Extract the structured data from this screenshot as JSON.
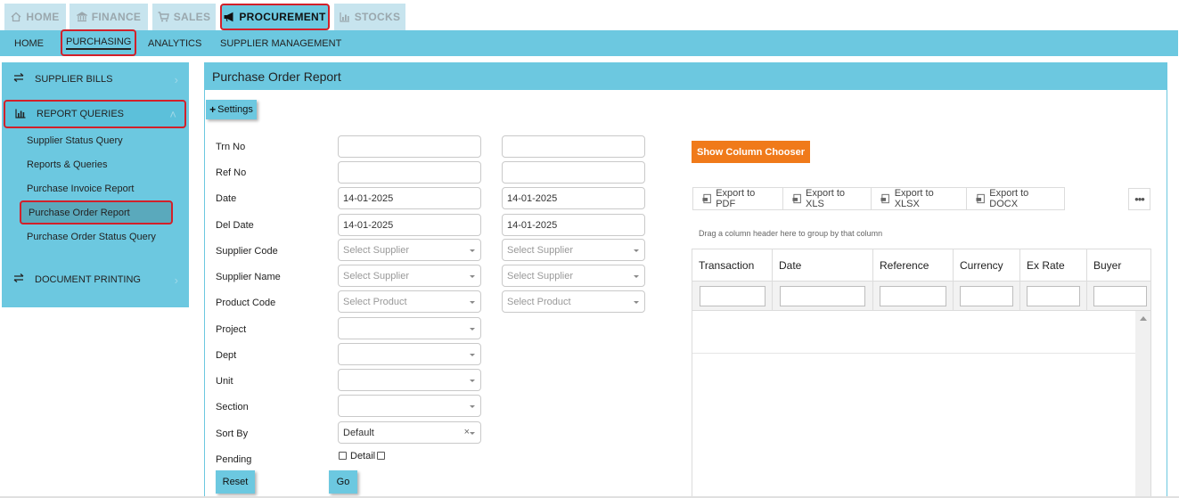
{
  "modules": [
    {
      "label": "HOME",
      "icon": "home-icon"
    },
    {
      "label": "FINANCE",
      "icon": "bank-icon"
    },
    {
      "label": "SALES",
      "icon": "cart-icon"
    },
    {
      "label": "PROCUREMENT",
      "icon": "megaphone-icon"
    },
    {
      "label": "STOCKS",
      "icon": "bar-chart-icon"
    }
  ],
  "subnav": [
    "HOME",
    "PURCHASING",
    "ANALYTICS",
    "SUPPLIER MANAGEMENT"
  ],
  "sidebar": {
    "sections": [
      {
        "label": "SUPPLIER BILLS",
        "icon": "exchange-icon",
        "chevron": "›"
      },
      {
        "label": "REPORT QUERIES",
        "icon": "bar-chart-icon",
        "chevron": "˄"
      },
      {
        "label": "DOCUMENT PRINTING",
        "icon": "exchange-icon",
        "chevron": "›"
      }
    ],
    "items": [
      "Supplier Status Query",
      "Reports & Queries",
      "Purchase Invoice Report",
      "Purchase Order Report",
      "Purchase Order Status Query"
    ]
  },
  "panel": {
    "title": "Purchase Order Report",
    "settings_label": "Settings"
  },
  "form": {
    "labels": [
      "Trn No",
      "Ref No",
      "Date",
      "Del Date",
      "Supplier Code",
      "Supplier Name",
      "Product Code",
      "Project",
      "Dept",
      "Unit",
      "Section",
      "Sort By",
      "Pending"
    ],
    "date_from": "14-01-2025",
    "date_to": "14-01-2025",
    "del_date_from": "14-01-2025",
    "del_date_to": "14-01-2025",
    "select_supplier": "Select Supplier",
    "select_product": "Select Product",
    "sort_by": "Default",
    "detail_label": "Detail",
    "clear_glyph": "×",
    "reset_label": "Reset",
    "go_label": "Go"
  },
  "grid": {
    "column_chooser_label": "Show Column Chooser",
    "exports": [
      "Export to PDF",
      "Export to XLS",
      "Export to XLSX",
      "Export to DOCX"
    ],
    "more_label": "•••",
    "group_hint": "Drag a column header here to group by that column",
    "columns": [
      "Transaction",
      "Date",
      "Reference",
      "Currency",
      "Ex Rate",
      "Buyer"
    ]
  },
  "colors": {
    "accent": "#6cc8e0",
    "highlight_border": "#d2202a",
    "orange_button": "#f07a1a"
  }
}
